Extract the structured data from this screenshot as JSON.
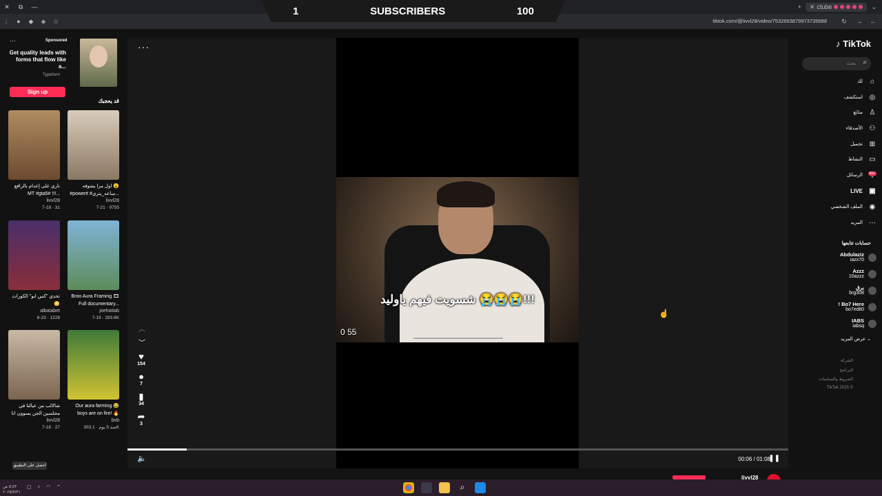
{
  "banner": {
    "left": "1",
    "label": "SUBSCRIBERS",
    "right": "100"
  },
  "browser": {
    "url": "tiktok.com/@livvl28/video/7532663879973735688",
    "tab_label": "ctube"
  },
  "left_panel": {
    "ad": {
      "sponsored": "Sponsored",
      "text": "Get quality leads with forms that flow like a...",
      "brand": "Typeform",
      "signup": "Sign up"
    },
    "you_may_like": "قد يعجبك",
    "cards": [
      {
        "title": "ناري على إعدام بالرافع MT #gta5# !!!...",
        "user": "livvl28",
        "meta": "7-18 · 31",
        "thumb_color": "#6b4a2f"
      },
      {
        "title": "اول مرا يشوفه 😮 #power# #ساعه_يتري...",
        "user": "livvl28",
        "meta": "7-21 · 9755",
        "thumb_color": "#c7b9a7"
      },
      {
        "title": "تحدي \"كس ابو\" الكورات 😳",
        "user": "albatabet",
        "meta": "6-23 · 1228",
        "thumb_color": "#8a2e3a"
      },
      {
        "title": "Broo Aura Framing 🎞 Full documentary...",
        "user": "joehattab",
        "meta": "7-19 · 283.6K",
        "thumb_color": "#5c8c5a"
      },
      {
        "title": "شالالب من عيالنا في مجلسين الجن يسوون انا كاليز...",
        "user": "livvl28",
        "meta": "7-18 · 27",
        "thumb_color": "#a78f76"
      },
      {
        "title": "Our aura farming 😂 boys are on fire! 🔥",
        "user": "bvb",
        "meta": "منذ 5 يوم · 303.1K",
        "thumb_color": "#d1c331"
      }
    ],
    "open_app": "احصل على التطبيق"
  },
  "video": {
    "caption": "شسويت فيهم ياوليد 😭😭😭!!!",
    "overlay_time": "0  55",
    "current_time": "00:06 / 01:08",
    "progress": 0.09,
    "likes": "154",
    "comments": "7",
    "saves": "34",
    "shares": "3",
    "author": "livvl28"
  },
  "right_panel": {
    "logo": "TikTok",
    "search_placeholder": "بحث",
    "nav": [
      {
        "label": "لك",
        "icon": "home-icon"
      },
      {
        "label": "استكشف",
        "icon": "compass-icon"
      },
      {
        "label": "متابَع",
        "icon": "follow-icon"
      },
      {
        "label": "الأصدقاء",
        "icon": "friends-icon"
      },
      {
        "label": "تحميل",
        "icon": "upload-icon"
      },
      {
        "label": "النشاط",
        "icon": "activity-icon"
      },
      {
        "label": "الرسائل",
        "icon": "messages-icon"
      },
      {
        "label": "LIVE",
        "icon": "live-icon"
      },
      {
        "label": "الملف الشخصي",
        "icon": "profile-icon"
      },
      {
        "label": "المزيد",
        "icon": "more-icon"
      }
    ],
    "messages_badge": "99+",
    "following_head": "حسابات تتابعها",
    "accounts": [
      {
        "name": "Abdulaziz",
        "handle": "iazx70"
      },
      {
        "name": "Azzz",
        "handle": "10azzz"
      },
      {
        "name": "برق",
        "handle": "brg308"
      },
      {
        "name": "! Bo7 Here",
        "handle": "bo7edit0"
      },
      {
        "name": "IABS",
        "handle": "iabsq"
      }
    ],
    "see_more": "عرض المزيد",
    "footer": [
      "الشركة",
      "البرنامج",
      "الشروط والسياسات",
      "TikTok 2025 ©"
    ]
  },
  "taskbar": {
    "time": "٥:٤٣ ص",
    "date": "٢٠٢٥/٧/٣١"
  }
}
